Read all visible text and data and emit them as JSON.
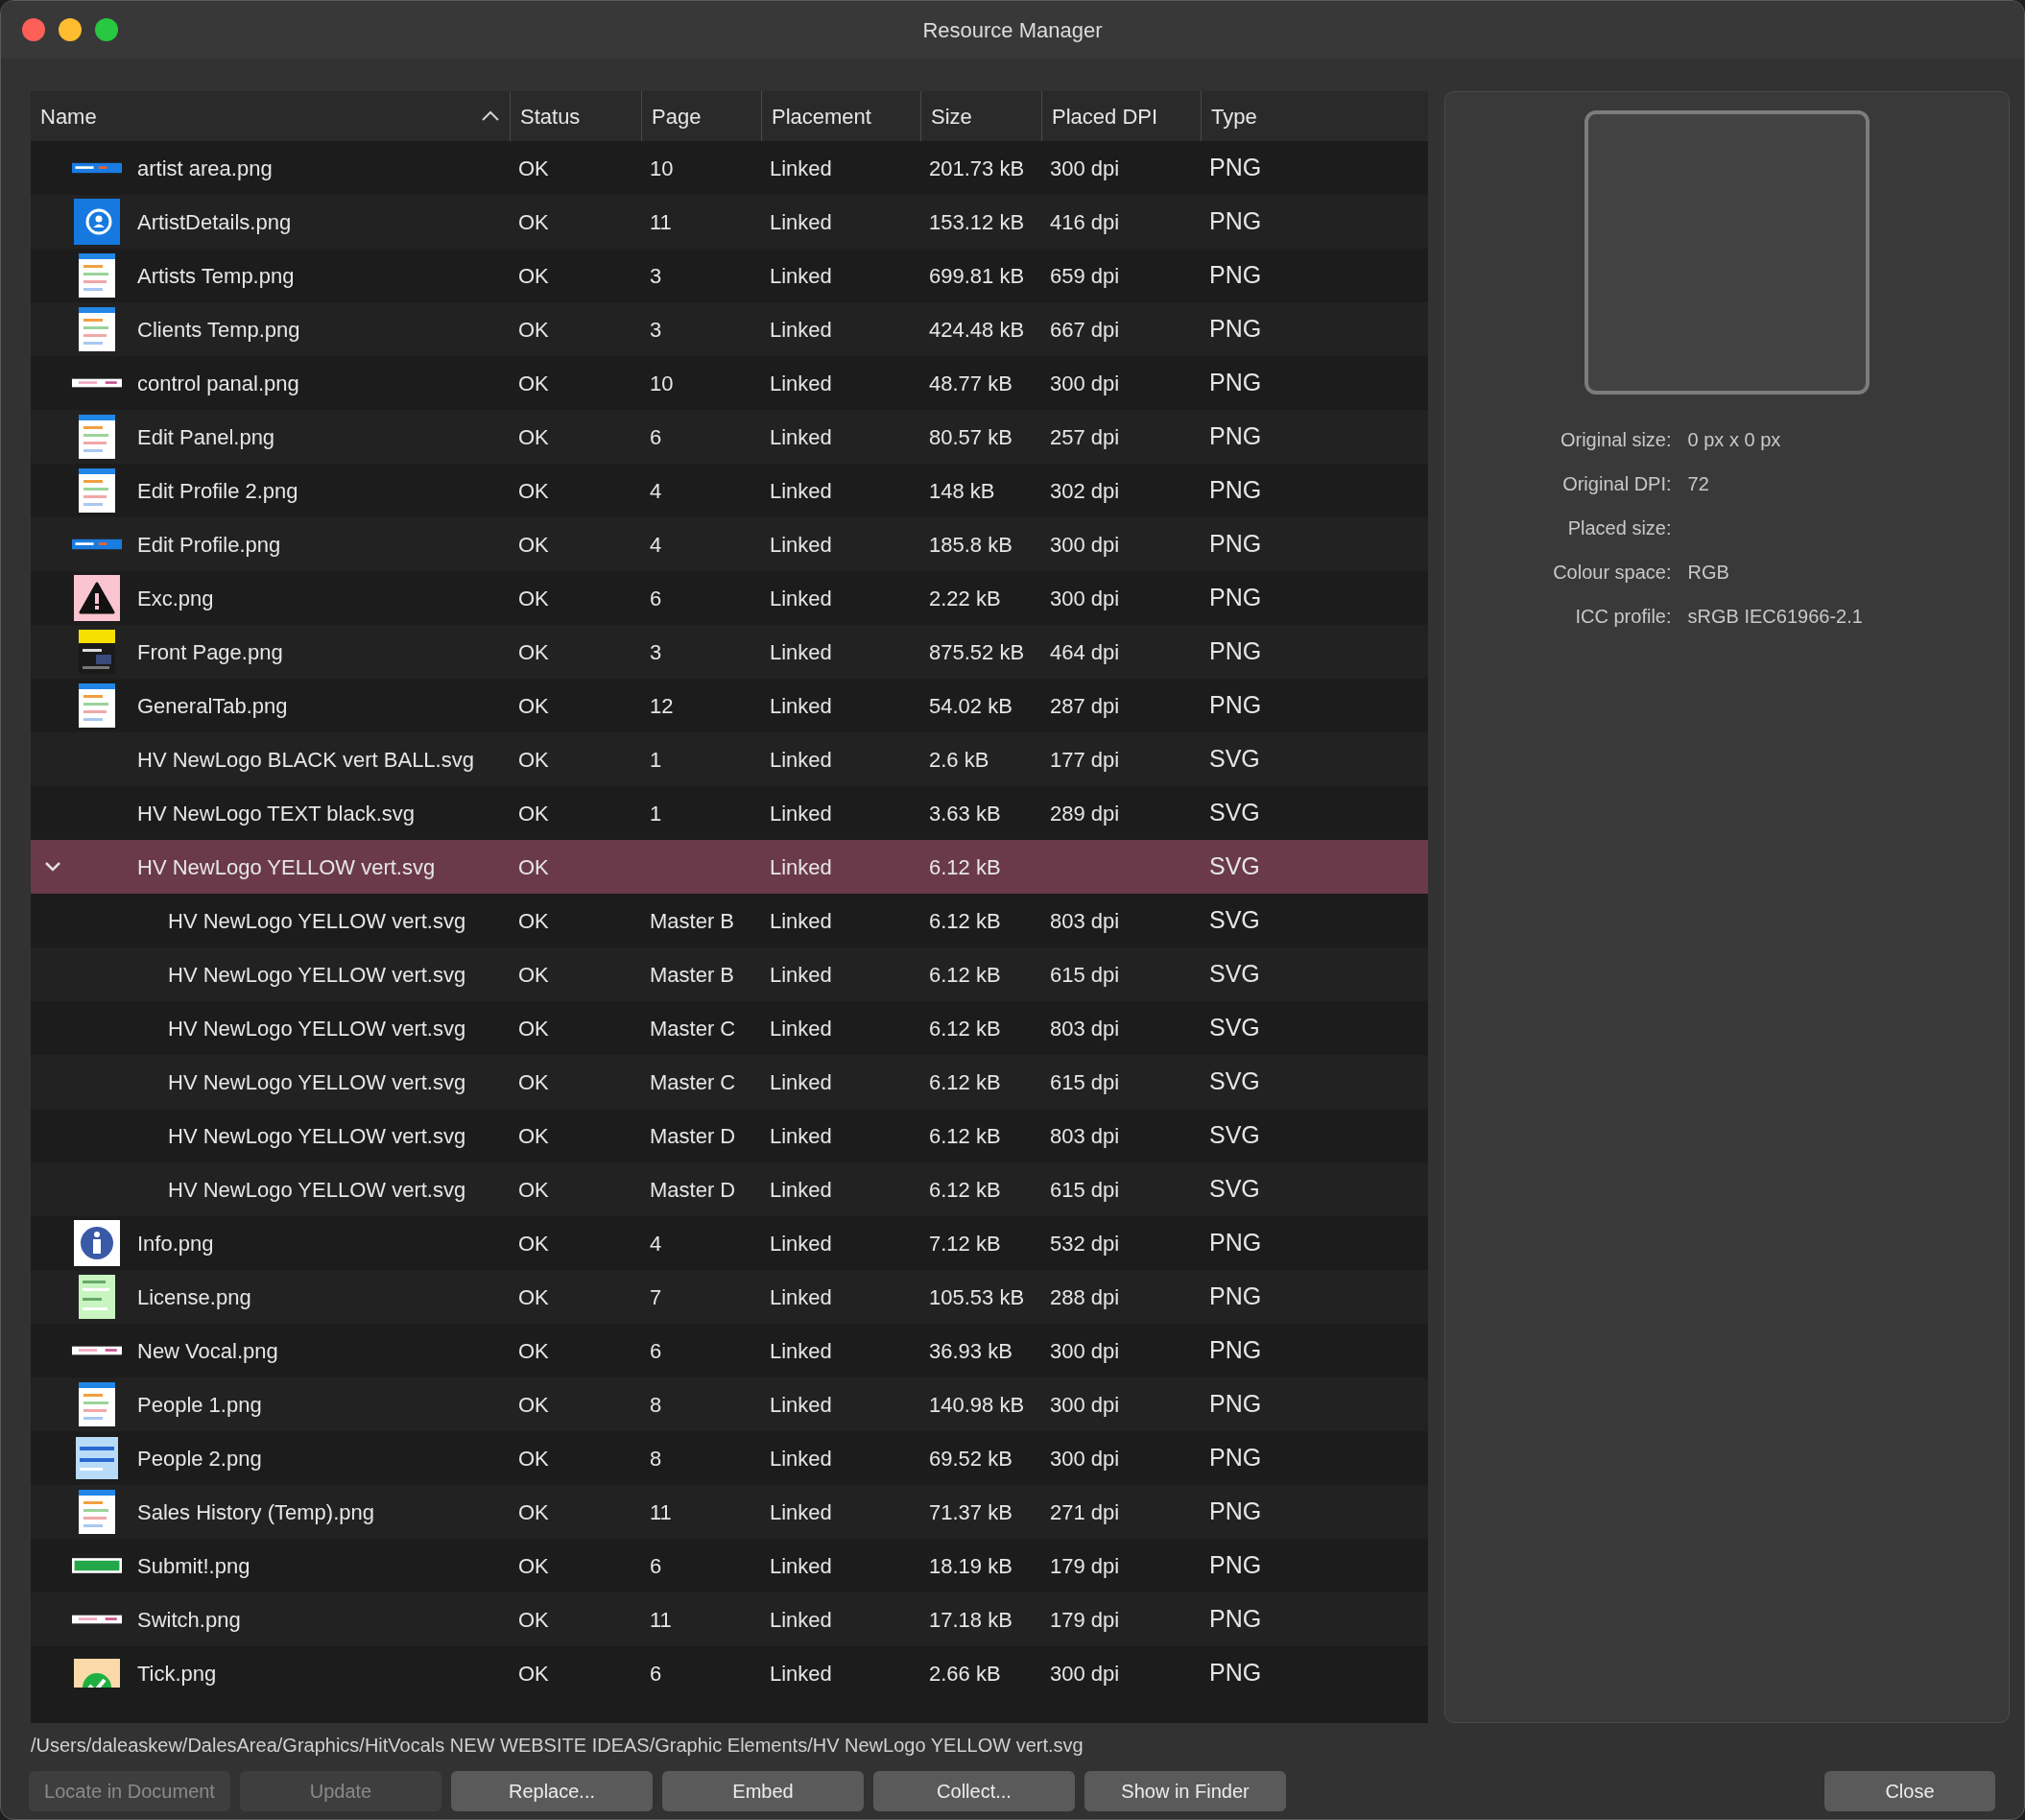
{
  "window": {
    "title": "Resource Manager"
  },
  "table": {
    "columns": [
      {
        "label": "Name",
        "sorted": true
      },
      {
        "label": "Status"
      },
      {
        "label": "Page"
      },
      {
        "label": "Placement"
      },
      {
        "label": "Size"
      },
      {
        "label": "Placed DPI"
      },
      {
        "label": "Type"
      }
    ],
    "rows": [
      {
        "name": "artist area.png",
        "status": "OK",
        "page": "10",
        "placement": "Linked",
        "size": "201.73 kB",
        "dpi": "300 dpi",
        "type": "PNG",
        "kind": "banner",
        "selected": false
      },
      {
        "name": "ArtistDetails.png",
        "status": "OK",
        "page": "11",
        "placement": "Linked",
        "size": "153.12 kB",
        "dpi": "416 dpi",
        "type": "PNG",
        "kind": "user",
        "selected": false
      },
      {
        "name": "Artists Temp.png",
        "status": "OK",
        "page": "3",
        "placement": "Linked",
        "size": "699.81 kB",
        "dpi": "659 dpi",
        "type": "PNG",
        "kind": "page",
        "selected": false
      },
      {
        "name": "Clients Temp.png",
        "status": "OK",
        "page": "3",
        "placement": "Linked",
        "size": "424.48 kB",
        "dpi": "667 dpi",
        "type": "PNG",
        "kind": "page",
        "selected": false
      },
      {
        "name": "control panal.png",
        "status": "OK",
        "page": "10",
        "placement": "Linked",
        "size": "48.77 kB",
        "dpi": "300 dpi",
        "type": "PNG",
        "kind": "strip",
        "selected": false
      },
      {
        "name": "Edit Panel.png",
        "status": "OK",
        "page": "6",
        "placement": "Linked",
        "size": "80.57 kB",
        "dpi": "257 dpi",
        "type": "PNG",
        "kind": "page",
        "selected": false
      },
      {
        "name": "Edit Profile 2.png",
        "status": "OK",
        "page": "4",
        "placement": "Linked",
        "size": "148 kB",
        "dpi": "302 dpi",
        "type": "PNG",
        "kind": "page",
        "selected": false
      },
      {
        "name": "Edit Profile.png",
        "status": "OK",
        "page": "4",
        "placement": "Linked",
        "size": "185.8 kB",
        "dpi": "300 dpi",
        "type": "PNG",
        "kind": "banner",
        "selected": false
      },
      {
        "name": "Exc.png",
        "status": "OK",
        "page": "6",
        "placement": "Linked",
        "size": "2.22 kB",
        "dpi": "300 dpi",
        "type": "PNG",
        "kind": "warning",
        "selected": false
      },
      {
        "name": "Front Page.png",
        "status": "OK",
        "page": "3",
        "placement": "Linked",
        "size": "875.52 kB",
        "dpi": "464 dpi",
        "type": "PNG",
        "kind": "darkpage",
        "selected": false
      },
      {
        "name": "GeneralTab.png",
        "status": "OK",
        "page": "12",
        "placement": "Linked",
        "size": "54.02 kB",
        "dpi": "287 dpi",
        "type": "PNG",
        "kind": "page",
        "selected": false
      },
      {
        "name": "HV NewLogo BLACK vert BALL.svg",
        "status": "OK",
        "page": "1",
        "placement": "Linked",
        "size": "2.6 kB",
        "dpi": "177 dpi",
        "type": "SVG",
        "selected": false
      },
      {
        "name": "HV NewLogo TEXT black.svg",
        "status": "OK",
        "page": "1",
        "placement": "Linked",
        "size": "3.63 kB",
        "dpi": "289 dpi",
        "type": "SVG",
        "selected": false
      },
      {
        "name": "HV NewLogo YELLOW vert.svg",
        "status": "OK",
        "placement": "Linked",
        "size": "6.12 kB",
        "type": "SVG",
        "selected": true,
        "expanded": true,
        "children": [
          {
            "name": "HV NewLogo YELLOW vert.svg",
            "status": "OK",
            "page": "Master B",
            "placement": "Linked",
            "size": "6.12 kB",
            "dpi": "803 dpi",
            "type": "SVG",
            "selected": false
          },
          {
            "name": "HV NewLogo YELLOW vert.svg",
            "status": "OK",
            "page": "Master B",
            "placement": "Linked",
            "size": "6.12 kB",
            "dpi": "615 dpi",
            "type": "SVG",
            "selected": false
          },
          {
            "name": "HV NewLogo YELLOW vert.svg",
            "status": "OK",
            "page": "Master C",
            "placement": "Linked",
            "size": "6.12 kB",
            "dpi": "803 dpi",
            "type": "SVG",
            "selected": false
          },
          {
            "name": "HV NewLogo YELLOW vert.svg",
            "status": "OK",
            "page": "Master C",
            "placement": "Linked",
            "size": "6.12 kB",
            "dpi": "615 dpi",
            "type": "SVG",
            "selected": false
          },
          {
            "name": "HV NewLogo YELLOW vert.svg",
            "status": "OK",
            "page": "Master D",
            "placement": "Linked",
            "size": "6.12 kB",
            "dpi": "803 dpi",
            "type": "SVG",
            "selected": false
          },
          {
            "name": "HV NewLogo YELLOW vert.svg",
            "status": "OK",
            "page": "Master D",
            "placement": "Linked",
            "size": "6.12 kB",
            "dpi": "615 dpi",
            "type": "SVG",
            "selected": false
          }
        ]
      },
      {
        "name": "Info.png",
        "status": "OK",
        "page": "4",
        "placement": "Linked",
        "size": "7.12 kB",
        "dpi": "532 dpi",
        "type": "PNG",
        "kind": "info",
        "selected": false
      },
      {
        "name": "License.png",
        "status": "OK",
        "page": "7",
        "placement": "Linked",
        "size": "105.53 kB",
        "dpi": "288 dpi",
        "type": "PNG",
        "kind": "greenpage",
        "selected": false
      },
      {
        "name": "New Vocal.png",
        "status": "OK",
        "page": "6",
        "placement": "Linked",
        "size": "36.93 kB",
        "dpi": "300 dpi",
        "type": "PNG",
        "kind": "strip",
        "selected": false
      },
      {
        "name": "People 1.png",
        "status": "OK",
        "page": "8",
        "placement": "Linked",
        "size": "140.98 kB",
        "dpi": "300 dpi",
        "type": "PNG",
        "kind": "page",
        "selected": false
      },
      {
        "name": "People 2.png",
        "status": "OK",
        "page": "8",
        "placement": "Linked",
        "size": "69.52 kB",
        "dpi": "300 dpi",
        "type": "PNG",
        "kind": "bluepage",
        "selected": false
      },
      {
        "name": "Sales History (Temp).png",
        "status": "OK",
        "page": "11",
        "placement": "Linked",
        "size": "71.37 kB",
        "dpi": "271 dpi",
        "type": "PNG",
        "kind": "page",
        "selected": false
      },
      {
        "name": "Submit!.png",
        "status": "OK",
        "page": "6",
        "placement": "Linked",
        "size": "18.19 kB",
        "dpi": "179 dpi",
        "type": "PNG",
        "kind": "greenstrip",
        "selected": false
      },
      {
        "name": "Switch.png",
        "status": "OK",
        "page": "11",
        "placement": "Linked",
        "size": "17.18 kB",
        "dpi": "179 dpi",
        "type": "PNG",
        "kind": "strip",
        "selected": false
      },
      {
        "name": "Tick.png",
        "status": "OK",
        "page": "6",
        "placement": "Linked",
        "size": "2.66 kB",
        "dpi": "300 dpi",
        "type": "PNG",
        "kind": "tick",
        "selected": false
      }
    ]
  },
  "path": "/Users/daleaskew/DalesArea/Graphics/HitVocals NEW WEBSITE IDEAS/Graphic Elements/HV NewLogo YELLOW vert.svg",
  "details": [
    {
      "label": "Original size:",
      "value": "0 px x 0 px"
    },
    {
      "label": "Original DPI:",
      "value": "72"
    },
    {
      "label": "Placed size:"
    },
    {
      "label": "Colour space:",
      "value": "RGB"
    },
    {
      "label": "ICC profile:",
      "value": "sRGB IEC61966-2.1"
    }
  ],
  "buttons": [
    {
      "label": "Locate in Document",
      "disabled": true
    },
    {
      "label": "Update",
      "disabled": true
    },
    {
      "label": "Replace...",
      "disabled": false
    },
    {
      "label": "Embed",
      "disabled": false
    },
    {
      "label": "Collect...",
      "disabled": false
    },
    {
      "label": "Show in Finder",
      "disabled": false
    }
  ],
  "close_button": {
    "label": "Close"
  }
}
